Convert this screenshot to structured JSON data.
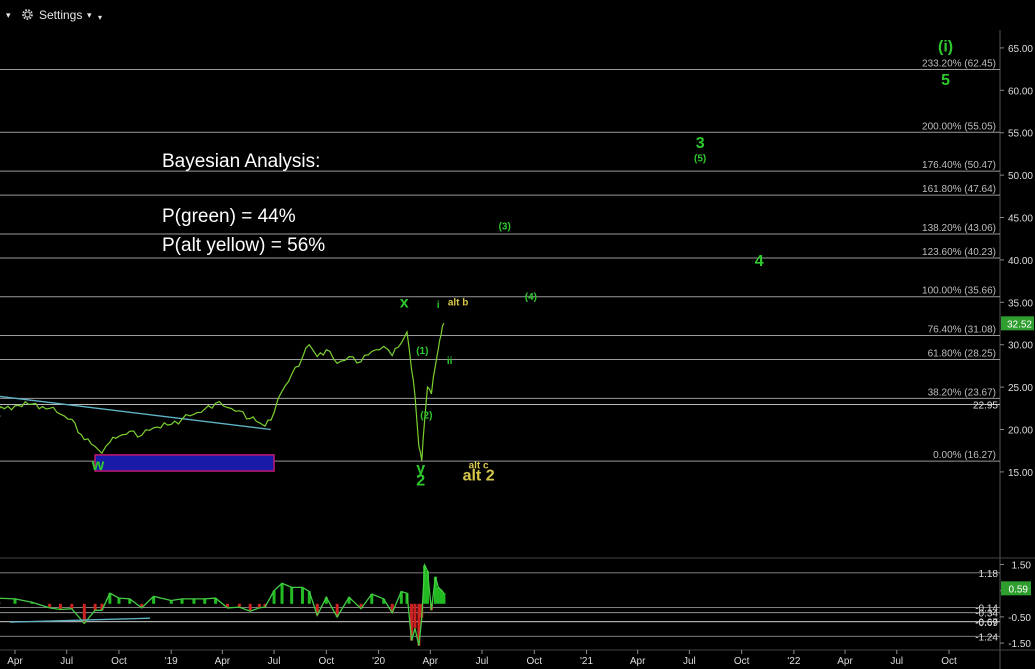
{
  "toolbar": {
    "menu_caret": "▾",
    "settings_label": "Settings",
    "settings_caret": "▾",
    "small_caret": "▾"
  },
  "colors": {
    "background": "#000000",
    "price_line": "#7bd02f",
    "green_label": "#2dc92d",
    "yellow_label": "#d8c84a",
    "fib_line": "#9a9a9a",
    "trend_line": "#5fb4c8",
    "support_box_fill": "#1a1aa8",
    "support_box_border": "#c01870",
    "indicator_line": "#44cc44",
    "indicator_signal": "#e0e0e0",
    "indicator_hist_neg": "#cc2222",
    "indicator_hist_pos": "#22bb22"
  },
  "icons": {
    "settings": "gear-icon"
  },
  "analysis_text": {
    "title": "Bayesian Analysis:",
    "line1": "P(green) = 44%",
    "line2": "P(alt yellow) = 56%"
  },
  "chart_data": {
    "type": "line",
    "title": "",
    "xlabel": "",
    "ylabel": "",
    "ylim": [
      12,
      66
    ],
    "y_ticks": [
      "65.00",
      "60.00",
      "55.00",
      "50.00",
      "45.00",
      "40.00",
      "35.00",
      "30.00",
      "25.00",
      "20.00",
      "15.00"
    ],
    "x_ticks": [
      "Apr",
      "Jul",
      "Oct",
      "'19",
      "Apr",
      "Jul",
      "Oct",
      "'20",
      "Apr",
      "Jul",
      "Oct",
      "'21",
      "Apr",
      "Jul",
      "Oct",
      "'22",
      "Apr",
      "Jul",
      "Oct"
    ],
    "x_tick_dates": [
      "2018-04-01",
      "2018-07-01",
      "2018-10-01",
      "2019-01-01",
      "2019-04-01",
      "2019-07-01",
      "2019-10-01",
      "2020-01-01",
      "2020-04-01",
      "2020-07-01",
      "2020-10-01",
      "2021-01-01",
      "2021-04-01",
      "2021-07-01",
      "2021-10-01",
      "2022-01-01",
      "2022-04-01",
      "2022-07-01",
      "2022-10-01"
    ],
    "series": [
      {
        "values": [
          [
            "2018-02-10",
            21.5
          ],
          [
            "2018-03-01",
            22.2
          ],
          [
            "2018-04-01",
            22.8
          ],
          [
            "2018-05-01",
            23.0
          ],
          [
            "2018-06-01",
            22.5
          ],
          [
            "2018-06-20",
            21.8
          ],
          [
            "2018-07-10",
            21.2
          ],
          [
            "2018-08-01",
            18.8
          ],
          [
            "2018-08-20",
            18.0
          ],
          [
            "2018-09-01",
            17.2
          ],
          [
            "2018-09-15",
            18.5
          ],
          [
            "2018-10-01",
            19.2
          ],
          [
            "2018-10-20",
            19.8
          ],
          [
            "2018-11-10",
            19.3
          ],
          [
            "2018-12-01",
            20.2
          ],
          [
            "2019-01-01",
            20.6
          ],
          [
            "2019-01-20",
            21.2
          ],
          [
            "2019-02-10",
            21.8
          ],
          [
            "2019-03-01",
            22.4
          ],
          [
            "2019-03-20",
            23.1
          ],
          [
            "2019-04-10",
            22.6
          ],
          [
            "2019-05-01",
            22.2
          ],
          [
            "2019-05-20",
            21.3
          ],
          [
            "2019-06-05",
            20.8
          ],
          [
            "2019-06-15",
            20.4
          ],
          [
            "2019-07-01",
            22.0
          ],
          [
            "2019-07-15",
            24.5
          ],
          [
            "2019-08-01",
            26.5
          ],
          [
            "2019-08-20",
            28.5
          ],
          [
            "2019-09-01",
            30.0
          ],
          [
            "2019-09-15",
            28.6
          ],
          [
            "2019-10-01",
            29.4
          ],
          [
            "2019-10-20",
            27.8
          ],
          [
            "2019-11-10",
            28.6
          ],
          [
            "2019-12-01",
            28.0
          ],
          [
            "2019-12-20",
            29.2
          ],
          [
            "2020-01-10",
            29.8
          ],
          [
            "2020-01-25",
            28.7
          ],
          [
            "2020-02-10",
            30.2
          ],
          [
            "2020-02-20",
            31.5
          ],
          [
            "2020-02-28",
            27.0
          ],
          [
            "2020-03-05",
            24.0
          ],
          [
            "2020-03-12",
            18.0
          ],
          [
            "2020-03-17",
            16.3
          ],
          [
            "2020-03-22",
            21.0
          ],
          [
            "2020-03-27",
            25.0
          ],
          [
            "2020-04-03",
            24.2
          ],
          [
            "2020-04-10",
            27.5
          ],
          [
            "2020-04-15",
            29.5
          ],
          [
            "2020-04-20",
            31.2
          ],
          [
            "2020-04-25",
            32.52
          ]
        ]
      }
    ],
    "fib_levels": [
      {
        "label": "233.20% (62.45)",
        "value": 62.45
      },
      {
        "label": "200.00% (55.05)",
        "value": 55.05
      },
      {
        "label": "176.40% (50.47)",
        "value": 50.47
      },
      {
        "label": "161.80% (47.64)",
        "value": 47.64
      },
      {
        "label": "138.20% (43.06)",
        "value": 43.06
      },
      {
        "label": "123.60% (40.23)",
        "value": 40.23
      },
      {
        "label": "100.00% (35.66)",
        "value": 35.66
      },
      {
        "label": "76.40% (31.08)",
        "value": 31.08
      },
      {
        "label": "61.80% (28.25)",
        "value": 28.25
      },
      {
        "label": "38.20% (23.67)",
        "value": 23.67
      },
      {
        "label": "0.00% (16.27)",
        "value": 16.27
      }
    ],
    "last_price_label": "32.52",
    "last_price": 32.52,
    "level_label": "22.95",
    "level_value": 22.95,
    "wave_labels": [
      {
        "text": "(i)",
        "color": "green",
        "size": "large",
        "date": "2022-09-25",
        "price": 64.6
      },
      {
        "text": "5",
        "color": "green",
        "size": "large",
        "date": "2022-09-25",
        "price": 60.6
      },
      {
        "text": "3",
        "color": "green",
        "size": "large",
        "date": "2021-07-20",
        "price": 53.2
      },
      {
        "text": "(5)",
        "color": "green",
        "size": "small",
        "date": "2021-07-20",
        "price": 51.6
      },
      {
        "text": "(3)",
        "color": "green",
        "size": "small",
        "date": "2020-08-10",
        "price": 43.6
      },
      {
        "text": "4",
        "color": "green",
        "size": "large",
        "date": "2021-11-01",
        "price": 39.3
      },
      {
        "text": "(4)",
        "color": "green",
        "size": "small",
        "date": "2020-09-25",
        "price": 35.3
      },
      {
        "text": "x",
        "color": "green",
        "size": "large",
        "date": "2020-02-15",
        "price": 34.4
      },
      {
        "text": "i",
        "color": "green",
        "size": "small",
        "date": "2020-04-15",
        "price": 34.3
      },
      {
        "text": "alt b",
        "color": "yellow",
        "size": "small",
        "date": "2020-05-20",
        "price": 34.6
      },
      {
        "text": "(1)",
        "color": "green",
        "size": "small",
        "date": "2020-03-18",
        "price": 28.9
      },
      {
        "text": "ii",
        "color": "green",
        "size": "small",
        "date": "2020-05-05",
        "price": 27.7
      },
      {
        "text": "(2)",
        "color": "green",
        "size": "small",
        "date": "2020-03-25",
        "price": 21.3
      },
      {
        "text": "w",
        "color": "green",
        "size": "large",
        "date": "2018-08-25",
        "price": 15.2
      },
      {
        "text": "y",
        "color": "green",
        "size": "large",
        "date": "2020-03-15",
        "price": 14.8
      },
      {
        "text": "2",
        "color": "green",
        "size": "large",
        "date": "2020-03-15",
        "price": 13.4
      },
      {
        "text": "alt c",
        "color": "yellow",
        "size": "small",
        "date": "2020-06-25",
        "price": 15.4
      },
      {
        "text": "alt 2",
        "color": "yellow",
        "size": "large",
        "date": "2020-06-25",
        "price": 14.0
      }
    ],
    "trendline": [
      [
        "2018-02-01",
        23.9
      ],
      [
        "2019-06-25",
        20.0
      ]
    ],
    "support_box": {
      "start": "2018-08-20",
      "end": "2019-07-01",
      "top": 17.0,
      "bottom": 15.1
    },
    "indicator": {
      "ylim": [
        -1.7,
        1.7
      ],
      "y_ticks": [
        "1.50",
        "0.50",
        "-0.50",
        "-1.50"
      ],
      "value_label": "0.59",
      "value": 0.59,
      "level_labels": [
        {
          "text": "1.18",
          "value": 1.18
        },
        {
          "text": "-0.14",
          "value": -0.14
        },
        {
          "text": "-0.34",
          "value": -0.34
        },
        {
          "text": "-0.67",
          "value": -0.67
        },
        {
          "text": "-0.69",
          "value": -0.69
        },
        {
          "text": "-1.24",
          "value": -1.24
        }
      ]
    }
  }
}
